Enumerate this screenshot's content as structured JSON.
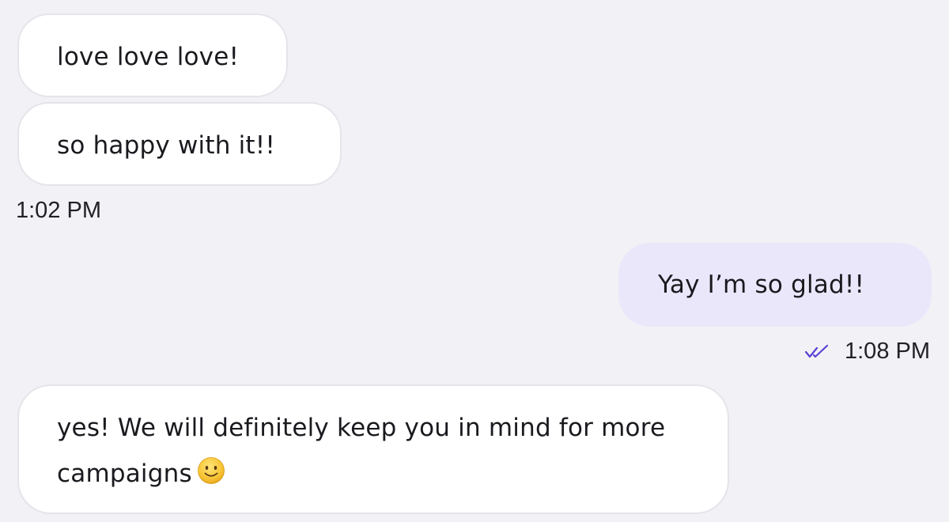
{
  "conversation": {
    "messages": [
      {
        "direction": "incoming",
        "text": "love love love!"
      },
      {
        "direction": "incoming",
        "text": "so happy with it!!"
      },
      {
        "direction": "outgoing",
        "text": "Yay I’m so glad!!"
      },
      {
        "direction": "incoming",
        "text": "yes! We will definitely keep you in mind for more campaigns",
        "emoji": "slightly-smiling-face"
      }
    ],
    "timestamps": {
      "first_group": "1:02 PM",
      "reply": "1:08 PM"
    },
    "read_receipt_icon": "double-check-icon",
    "colors": {
      "background": "#f2f2f6",
      "incoming_bubble": "#ffffff",
      "outgoing_bubble": "#ebe7fb",
      "read_receipt": "#5b3fd6"
    }
  }
}
